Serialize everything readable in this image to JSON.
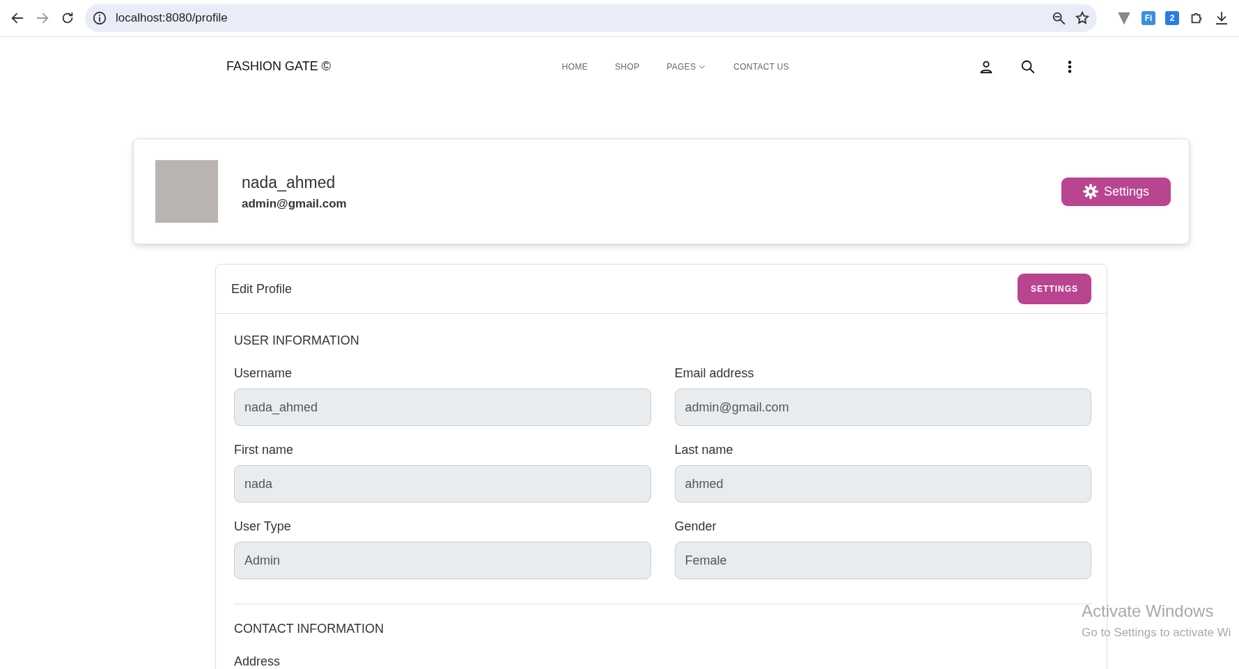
{
  "browser": {
    "url": "localhost:8080/profile",
    "forward_disabled": true,
    "extensions": [
      {
        "kind": "v"
      },
      {
        "kind": "badge",
        "text": "Fi",
        "color": "#3b8ee0"
      },
      {
        "kind": "badge",
        "text": "2",
        "color": "#2a7be4"
      },
      {
        "kind": "puzzle"
      }
    ]
  },
  "navbar": {
    "brand": "FASHION GATE ©",
    "links": [
      {
        "label": "HOME",
        "dropdown": false
      },
      {
        "label": "SHOP",
        "dropdown": false
      },
      {
        "label": "PAGES",
        "dropdown": true
      },
      {
        "label": "CONTACT US",
        "dropdown": false
      }
    ]
  },
  "profile": {
    "name": "nada_ahmed",
    "email": "admin@gmail.com",
    "button": "Settings"
  },
  "edit_card": {
    "title": "Edit Profile",
    "button": "SETTINGS",
    "sections": [
      {
        "heading": "USER INFORMATION",
        "fields": [
          {
            "label": "Username",
            "value": "nada_ahmed",
            "disabled": true
          },
          {
            "label": "Email address",
            "value": "admin@gmail.com",
            "disabled": true
          },
          {
            "label": "First name",
            "value": "nada",
            "disabled": true
          },
          {
            "label": "Last name",
            "value": "ahmed",
            "disabled": true
          },
          {
            "label": "User Type",
            "value": "Admin",
            "disabled": true
          },
          {
            "label": "Gender",
            "value": "Female",
            "disabled": true
          }
        ]
      },
      {
        "heading": "CONTACT INFORMATION",
        "fields": [
          {
            "label": "Address"
          }
        ]
      }
    ]
  },
  "os_notice": {
    "title": "Activate Windows",
    "text": "Go to Settings to activate Wi"
  }
}
